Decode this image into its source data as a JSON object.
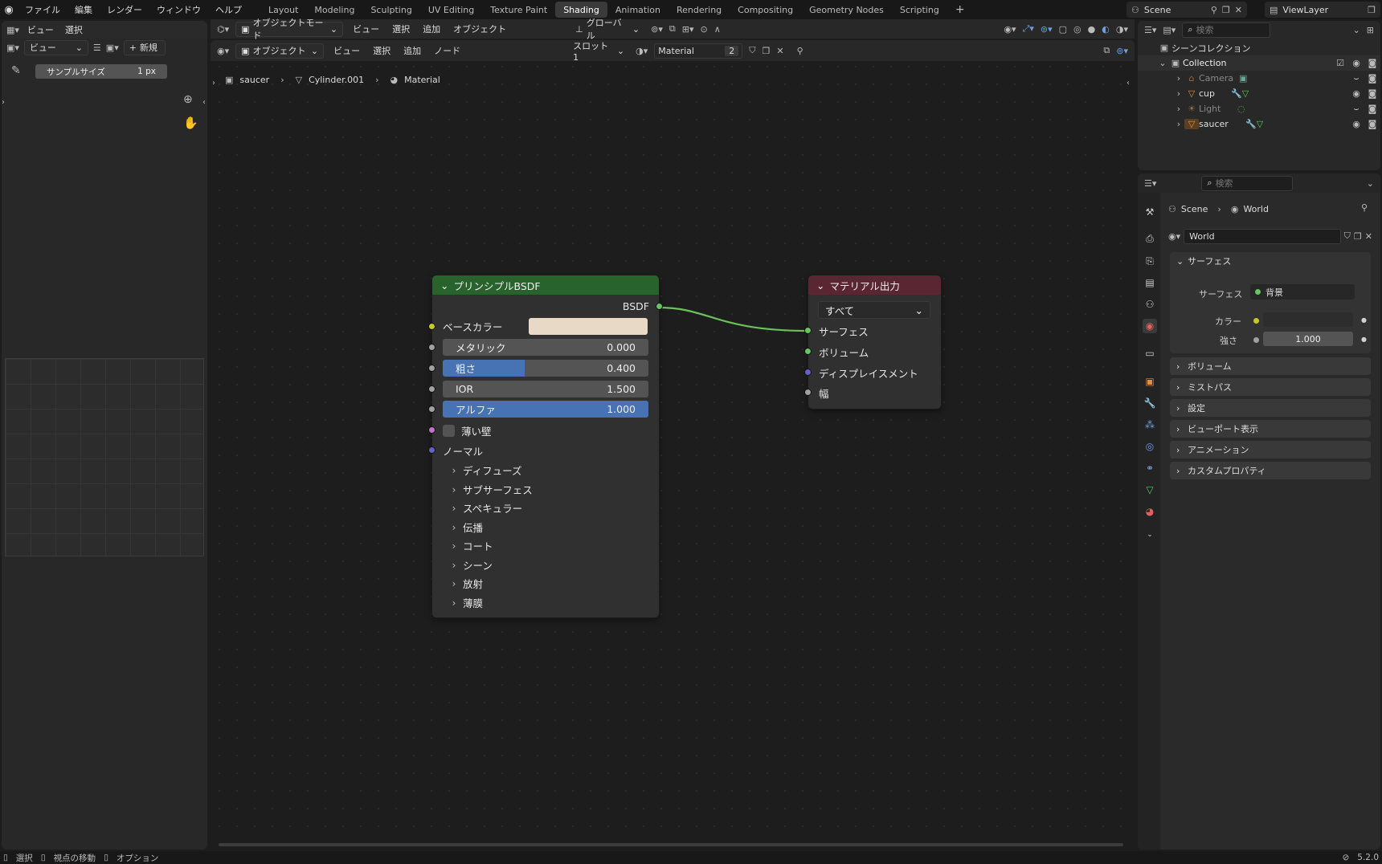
{
  "topbar": {
    "menus": [
      "ファイル",
      "編集",
      "レンダー",
      "ウィンドウ",
      "ヘルプ"
    ],
    "workspaces": [
      "Layout",
      "Modeling",
      "Sculpting",
      "UV Editing",
      "Texture Paint",
      "Shading",
      "Animation",
      "Rendering",
      "Compositing",
      "Geometry Nodes",
      "Scripting"
    ],
    "active_workspace": "Shading",
    "scene": "Scene",
    "view_layer": "ViewLayer"
  },
  "image_editor": {
    "view": "ビュー",
    "select": "選択",
    "view_dd": "ビュー",
    "new": "新規",
    "sample_label": "サンプルサイズ",
    "sample_value": "1 px"
  },
  "viewport_hdr": {
    "mode": "オブジェクトモード",
    "menus": [
      "ビュー",
      "選択",
      "追加",
      "オブジェクト"
    ],
    "orient": "グローバル"
  },
  "node_hdr": {
    "type": "オブジェクト",
    "menus": [
      "ビュー",
      "選択",
      "追加",
      "ノード"
    ],
    "slot": "スロット1",
    "material": "Material",
    "users": "2"
  },
  "breadcrumb": {
    "obj": "saucer",
    "mesh": "Cylinder.001",
    "mat": "Material"
  },
  "bsdf": {
    "title": "プリンシプルBSDF",
    "out": "BSDF",
    "base_color": "ベースカラー",
    "base_color_value": "#e8d9c6",
    "metallic": "メタリック",
    "metallic_val": "0.000",
    "roughness": "粗さ",
    "roughness_val": "0.400",
    "roughness_frac": 0.4,
    "ior": "IOR",
    "ior_val": "1.500",
    "alpha": "アルファ",
    "alpha_val": "1.000",
    "alpha_frac": 1.0,
    "thin": "薄い壁",
    "normal": "ノーマル",
    "panels": [
      "ディフューズ",
      "サブサーフェス",
      "スペキュラー",
      "伝播",
      "コート",
      "シーン",
      "放射",
      "薄膜"
    ]
  },
  "matout": {
    "title": "マテリアル出力",
    "target": "すべて",
    "surface": "サーフェス",
    "volume": "ボリューム",
    "displacement": "ディスプレイスメント",
    "thickness": "幅"
  },
  "outliner": {
    "search": "検索",
    "scene_collection": "シーンコレクション",
    "collection": "Collection",
    "items": [
      "Camera",
      "cup",
      "Light",
      "saucer"
    ]
  },
  "props": {
    "search": "検索",
    "crumb_scene": "Scene",
    "crumb_world": "World",
    "world_name": "World",
    "surface_panel": "サーフェス",
    "surface_label": "サーフェス",
    "surface_value": "背景",
    "color_label": "カラー",
    "strength_label": "強さ",
    "strength_value": "1.000",
    "sections": [
      "ボリューム",
      "ミストパス",
      "設定",
      "ビューポート表示",
      "アニメーション",
      "カスタムプロパティ"
    ]
  },
  "status": {
    "select": "選択",
    "pan": "視点の移動",
    "options": "オプション",
    "version": "5.2.0"
  },
  "colors": {
    "bsdf_header": "#27632a",
    "output_header": "#5a2631",
    "link": "#6cc05a",
    "socket_yellow": "#c7c729",
    "socket_gray": "#a1a1a1",
    "socket_purple": "#6363c7",
    "socket_pink": "#cc6fcc",
    "socket_green": "#63c763",
    "accent_blue": "#4772b3"
  }
}
